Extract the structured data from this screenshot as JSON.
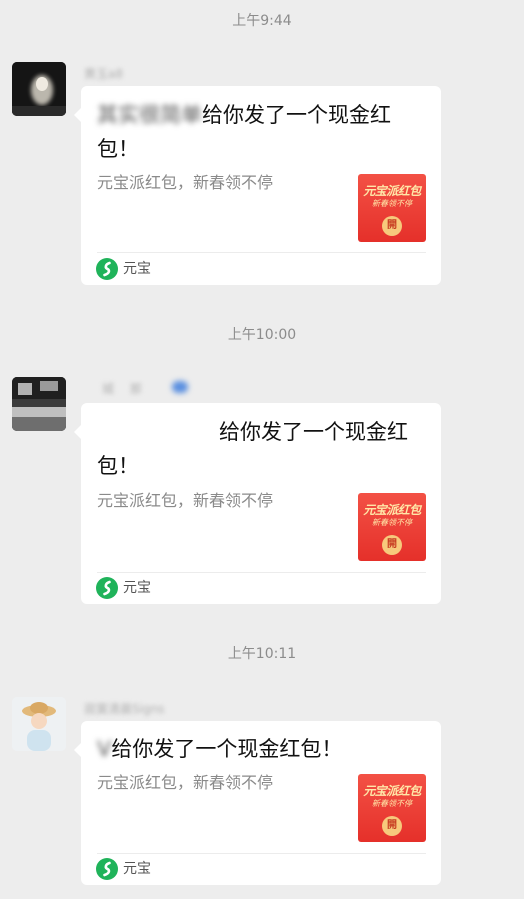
{
  "messages": [
    {
      "time": "上午9:44",
      "sender": "黄玉a8",
      "sender_prefix": "其实很简单",
      "title_text": "给你发了一个现金红包！",
      "subtitle": "元宝派红包，新春领不停",
      "thumb_line1": "元宝派红包",
      "thumb_line2": "新春领不停",
      "thumb_coin": "開",
      "footer": "元宝"
    },
    {
      "time": "上午10:00",
      "sender": "城 那",
      "sender_prefix": "",
      "title_text": "给你发了一个现金红包！",
      "subtitle": "元宝派红包，新春领不停",
      "thumb_line1": "元宝派红包",
      "thumb_line2": "新春领不停",
      "thumb_coin": "開",
      "footer": "元宝"
    },
    {
      "time": "上午10:11",
      "sender": "寂寞清晨Signs",
      "sender_prefix": "V",
      "title_text": "给你发了一个现金红包！",
      "subtitle": "元宝派红包，新春领不停",
      "thumb_line1": "元宝派红包",
      "thumb_line2": "新春领不停",
      "thumb_coin": "開",
      "footer": "元宝"
    }
  ],
  "colors": {
    "background": "#ededed",
    "card": "#ffffff",
    "redpacket": "#e5302a",
    "yuanbao_green": "#1fb35a"
  }
}
